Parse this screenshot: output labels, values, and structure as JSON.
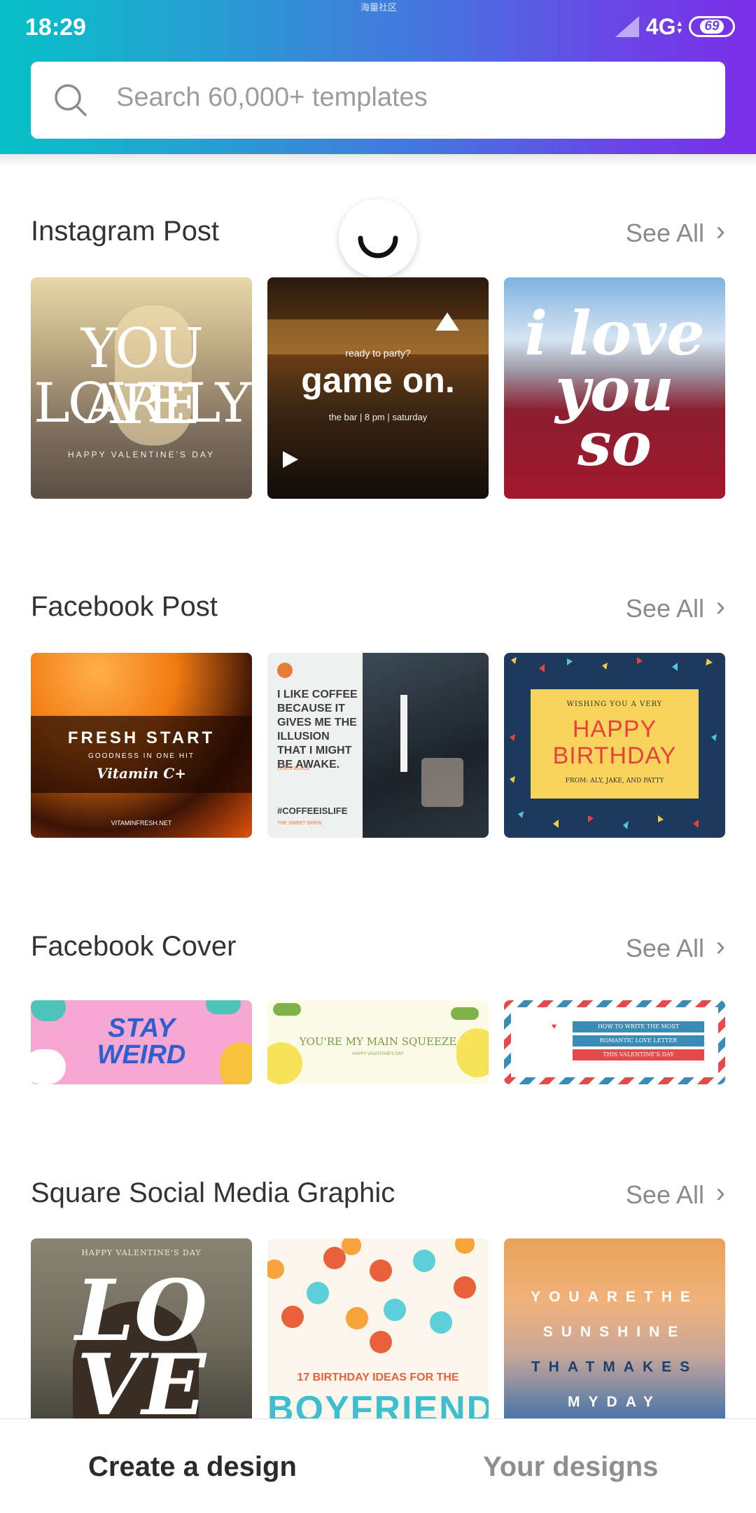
{
  "status_bar": {
    "time": "18:29",
    "carrier_label": "海量社区",
    "network": "4G",
    "battery": "69"
  },
  "search": {
    "placeholder": "Search 60,000+ templates"
  },
  "sections": [
    {
      "title": "Instagram Post",
      "see_all": "See All",
      "cards": [
        {
          "line1": "YOU ARE",
          "line2": "LOVELY",
          "line3": "HAPPY VALENTINE'S DAY"
        },
        {
          "small": "ready to party?",
          "main": "game on.",
          "sub": "the bar  |  8 pm  |  saturday"
        },
        {
          "line1": "i love",
          "line2": "you",
          "line3": "so"
        }
      ]
    },
    {
      "title": "Facebook Post",
      "see_all": "See All",
      "cards": [
        {
          "line1": "FRESH START",
          "line2": "GOODNESS IN ONE HIT",
          "line3": "Vitamin C+",
          "line4": "VITAMINFRESH.NET"
        },
        {
          "quote": "I LIKE COFFEE BECAUSE IT GIVES ME THE ILLUSION THAT I MIGHT BE AWAKE.",
          "author": "LEWIS BLACK",
          "tag": "#COFFEEISLIFE",
          "brand": "THE SWEET BREW"
        },
        {
          "line1": "WISHING YOU A VERY",
          "line2": "HAPPY",
          "line3": "BIRTHDAY",
          "line4": "FROM: ALY, JAKE, AND PATTY"
        }
      ]
    },
    {
      "title": "Facebook Cover",
      "see_all": "See All",
      "cards": [
        {
          "line1": "STAY",
          "line2": "WEIRD"
        },
        {
          "line1": "YOU'RE MY MAIN SQUEEZE",
          "line2": "HAPPY VALENTINE'S DAY"
        },
        {
          "line1": "HOW TO WRITE THE MOST",
          "line2": "ROMANTIC LOVE LETTER",
          "line3": "THIS VALENTINE'S DAY"
        }
      ]
    },
    {
      "title": "Square Social Media Graphic",
      "see_all": "See All",
      "cards": [
        {
          "line1": "HAPPY VALENTINE'S DAY",
          "line2": "LO",
          "line3": "VE"
        },
        {
          "line1": "17 BIRTHDAY IDEAS FOR THE",
          "line2": "BOYFRIEND"
        },
        {
          "line1": "YOUARETHE",
          "line2": "SUNSHINE",
          "line3": "THATMAKES",
          "line4": "MYDAY"
        }
      ]
    }
  ],
  "bottom_tabs": {
    "create": "Create a design",
    "yours": "Your designs"
  },
  "colors": {
    "header_start": "#06c1c7",
    "header_end": "#7a2ee8",
    "birthday_red": "#e8413f",
    "navy": "#1d3a5c"
  }
}
